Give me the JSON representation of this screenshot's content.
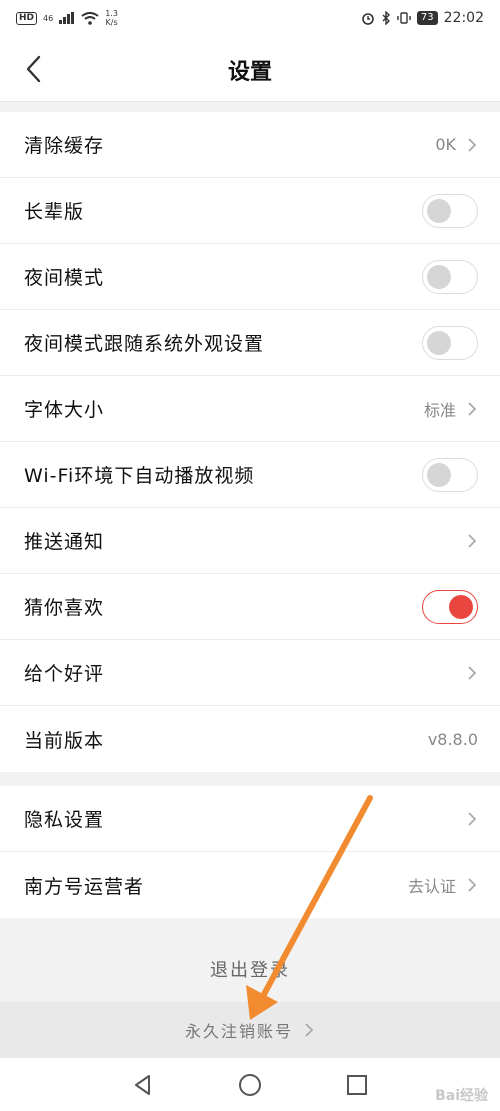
{
  "status_bar": {
    "hd": "HD",
    "signal_tag": "46",
    "net_speed_value": "1.3",
    "net_speed_unit": "K/s",
    "battery": "73",
    "time": "22:02"
  },
  "header": {
    "title": "设置"
  },
  "settings": [
    {
      "label": "清除缓存",
      "value": "0K"
    },
    {
      "label": "长辈版",
      "toggle": false
    },
    {
      "label": "夜间模式",
      "toggle": false
    },
    {
      "label": "夜间模式跟随系统外观设置",
      "toggle": false
    },
    {
      "label": "字体大小",
      "value": "标准"
    },
    {
      "label": "Wi-Fi环境下自动播放视频",
      "toggle": false
    },
    {
      "label": "推送通知"
    },
    {
      "label": "猜你喜欢",
      "toggle": true
    },
    {
      "label": "给个好评"
    },
    {
      "label": "当前版本",
      "value": "v8.8.0"
    }
  ],
  "settings2": [
    {
      "label": "隐私设置"
    },
    {
      "label": "南方号运营者",
      "value": "去认证"
    }
  ],
  "footer": {
    "logout_label": "退出登录",
    "delete_account_label": "永久注销账号"
  },
  "watermark": "Bai经验",
  "colors": {
    "accent": "#e8463f",
    "annotation_arrow": "#f28b30"
  },
  "icons": {
    "back": "chevron-left-icon",
    "chevron": "chevron-right-icon",
    "nav_back": "triangle-back-icon",
    "nav_home": "circle-home-icon",
    "nav_recent": "square-recent-icon"
  }
}
